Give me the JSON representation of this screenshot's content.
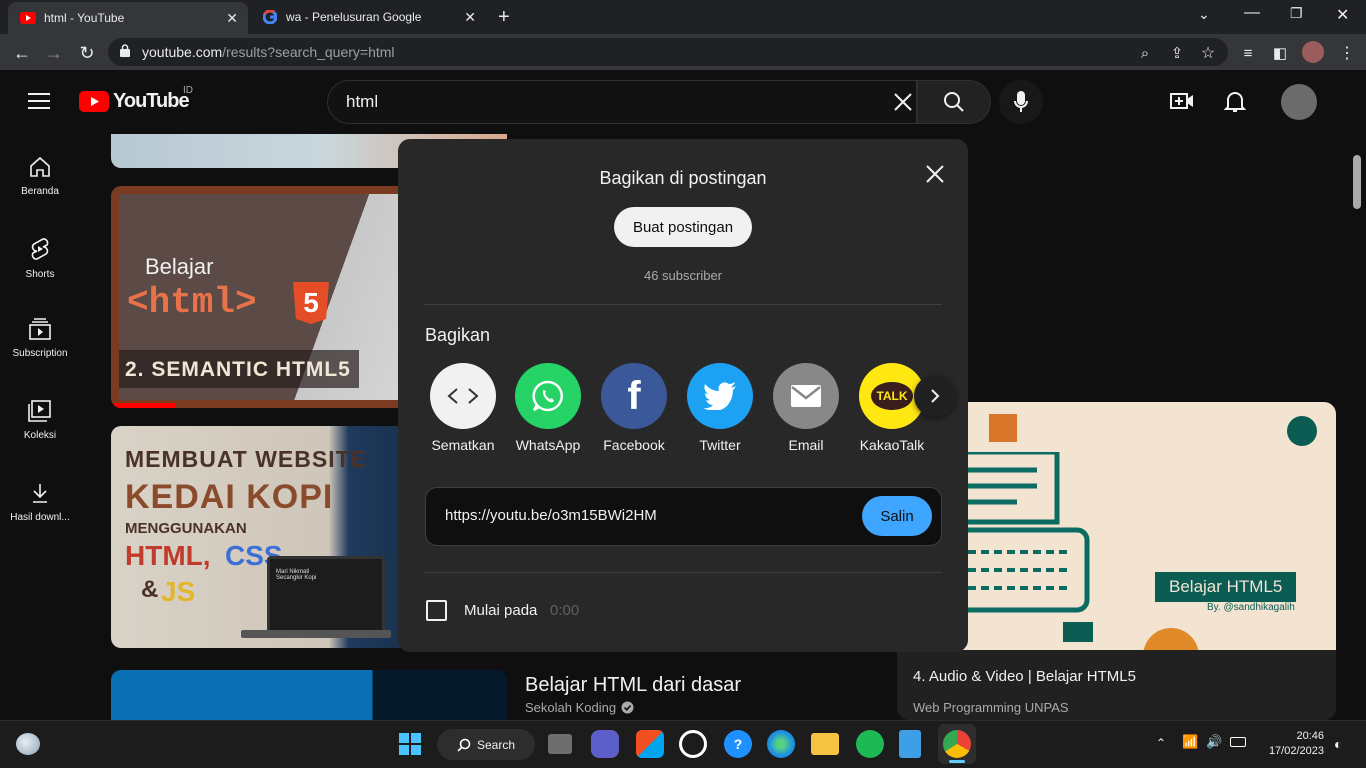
{
  "browser": {
    "tabs": [
      {
        "title": "html - YouTube",
        "icon": "youtube-icon"
      },
      {
        "title": "wa - Penelusuran Google",
        "icon": "google-icon"
      }
    ],
    "url_domain": "youtube.com",
    "url_path": "/results?search_query=html"
  },
  "yt": {
    "logo_text": "YouTube",
    "region": "ID",
    "search_value": "html",
    "sidebar": [
      {
        "label": "Beranda",
        "icon": "home-icon"
      },
      {
        "label": "Shorts",
        "icon": "shorts-icon"
      },
      {
        "label": "Subscription",
        "icon": "subscriptions-icon"
      },
      {
        "label": "Koleksi",
        "icon": "library-icon"
      },
      {
        "label": "Hasil downl...",
        "icon": "download-icon"
      }
    ]
  },
  "thumbs": {
    "t1": {
      "line1": "Belajar",
      "line2": "<html>",
      "badge": "5",
      "caption": "2. SEMANTIC HTML5"
    },
    "t2": {
      "l1": "MEMBUAT WEBSITE",
      "l2": "KEDAI KOPI",
      "l3": "MENGGUNAKAN",
      "l4a": "HTML,",
      "l4b": "CSS",
      "l5a": "&",
      "l5b": "JS",
      "screen": "Mari Nikmati Secangkir Kopi"
    },
    "t3": {
      "label": "Belajar HTML5",
      "by": "By. @sandhikagalih"
    }
  },
  "results": [
    {
      "title": "Belajar HTML dari dasar",
      "channel": "Sekolah Koding"
    },
    {
      "title": "4. Audio & Video | Belajar HTML5",
      "channel": "Web Programming UNPAS"
    }
  ],
  "modal": {
    "title": "Bagikan di postingan",
    "post_button": "Buat postingan",
    "subscribers": "46 subscriber",
    "share_heading": "Bagikan",
    "targets": [
      {
        "label": "Sematkan",
        "color": "#f1f1f1",
        "icon": "embed-icon"
      },
      {
        "label": "WhatsApp",
        "color": "#25d366",
        "icon": "whatsapp-icon"
      },
      {
        "label": "Facebook",
        "color": "#3b5998",
        "icon": "facebook-icon"
      },
      {
        "label": "Twitter",
        "color": "#1da1f2",
        "icon": "twitter-icon"
      },
      {
        "label": "Email",
        "color": "#888888",
        "icon": "email-icon"
      },
      {
        "label": "KakaoTalk",
        "color": "#ffe812",
        "icon": "kakaotalk-icon",
        "icon_text": "TALK"
      }
    ],
    "link": "https://youtu.be/o3m15BWi2HM",
    "copy_button": "Salin",
    "start_label": "Mulai pada",
    "start_time": "0:00"
  },
  "taskbar": {
    "search_label": "Search",
    "time": "20:46",
    "date": "17/02/2023"
  }
}
